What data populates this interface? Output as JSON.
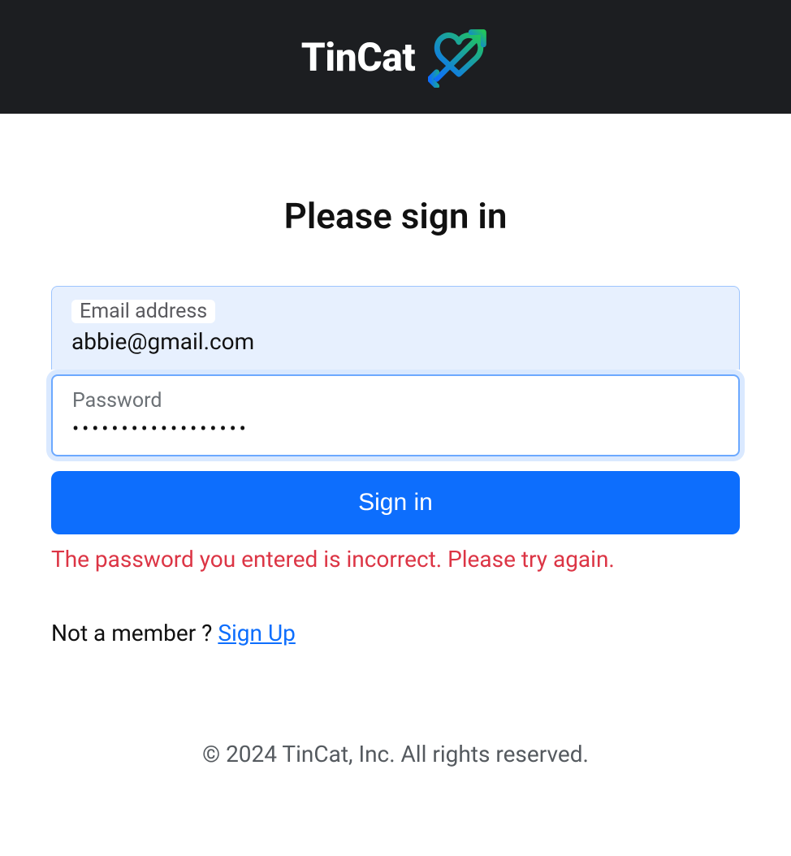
{
  "header": {
    "brand": "TinCat"
  },
  "form": {
    "title": "Please sign in",
    "email_label": "Email address",
    "email_value": "abbie@gmail.com",
    "password_label": "Password",
    "password_value": "••••••••••••••••••",
    "submit_label": "Sign in",
    "error_message": "The password you entered is incorrect. Please try again."
  },
  "signup": {
    "prompt": "Not a member ? ",
    "link_label": "Sign Up"
  },
  "footer": {
    "copyright": "© 2024 TinCat, Inc. All rights reserved."
  }
}
